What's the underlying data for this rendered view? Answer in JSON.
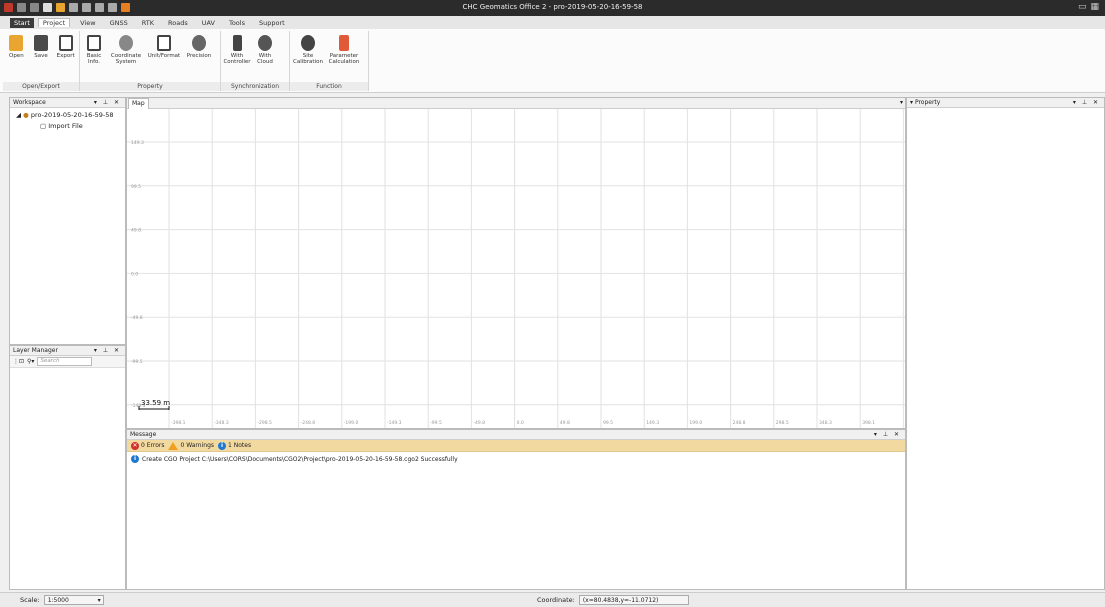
{
  "window": {
    "title": "CHC Geomatics Office 2 - pro-2019-05-20-16-59-58"
  },
  "menu": [
    "Start",
    "Project",
    "View",
    "GNSS",
    "RTK",
    "Roads",
    "UAV",
    "Tools",
    "Support"
  ],
  "ribbon": {
    "groups": [
      {
        "label": "Open/Export",
        "buttons": [
          "Open",
          "Save",
          "Export"
        ]
      },
      {
        "label": "Property",
        "buttons": [
          "Basic\nInfo.",
          "Coordinate\nSystem",
          "Unit/Format",
          "Precision"
        ]
      },
      {
        "label": "Synchronization",
        "buttons": [
          "With\nController",
          "With\nCloud"
        ]
      },
      {
        "label": "Function",
        "buttons": [
          "Site\nCalibration",
          "Parameter\nCalculation"
        ]
      }
    ]
  },
  "workspace": {
    "title": "Workspace",
    "project": "pro-2019-05-20-16-59-58",
    "child": "Import File"
  },
  "layer_manager": {
    "title": "Layer Manager",
    "search_placeholder": "Search"
  },
  "map": {
    "tab": "Map",
    "y_ticks": [
      "149.3",
      "99.5",
      "49.8",
      "0.0",
      "-49.8",
      "-99.5",
      "-149.3"
    ],
    "x_ticks": [
      "-398.1",
      "-348.3",
      "-298.5",
      "-248.8",
      "-199.0",
      "-149.3",
      "-99.5",
      "-49.8",
      "0.0",
      "49.8",
      "99.5",
      "149.3",
      "199.0",
      "248.8",
      "298.5",
      "348.3",
      "398.1"
    ],
    "scale_label": "33.59 m"
  },
  "message": {
    "title": "Message",
    "errors": "0 Errors",
    "warnings": "0 Warnings",
    "notes": "1 Notes",
    "line": "Create CGO Project C:\\Users\\CORS\\Documents\\CGO2\\Project\\pro-2019-05-20-16-59-58.cgo2 Successfully"
  },
  "property": {
    "title": "Property"
  },
  "status": {
    "scale_label": "Scale:",
    "scale_value": "1:5000",
    "coord_label": "Coordinate:",
    "coord_value": "(x=80.4838,y=-11.0712)"
  },
  "colors": {
    "title_bg": "#2b2b2b",
    "msg_bar": "#f2d9a0",
    "error": "#d0302a",
    "warning": "#f0a020",
    "note": "#1e78d2"
  }
}
